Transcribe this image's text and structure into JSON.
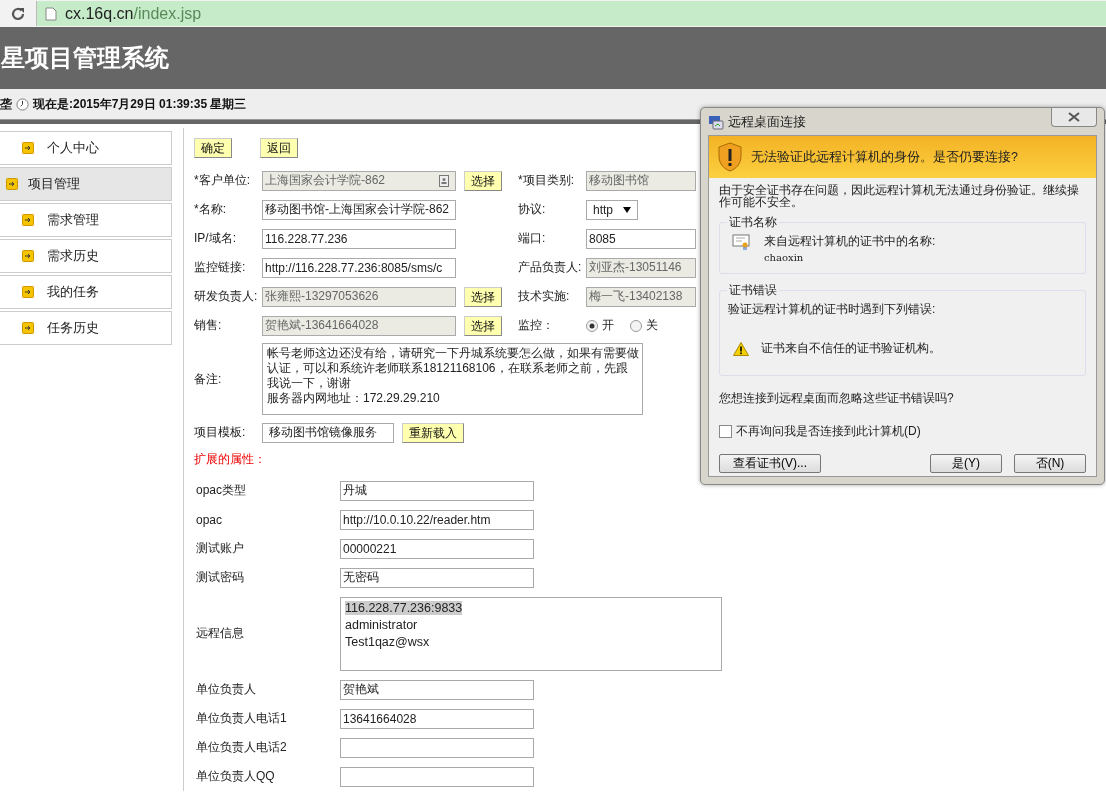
{
  "browser": {
    "url_host": "cx.16q.cn",
    "url_path": "/index.jsp"
  },
  "header": {
    "title": "星项目管理系统",
    "user": "垄",
    "datetime": "现在是:2015年7月29日 01:39:35 星期三"
  },
  "sidebar": {
    "items": [
      {
        "label": "个人中心",
        "selected": false
      },
      {
        "label": "项目管理",
        "selected": true
      },
      {
        "label": "需求管理",
        "selected": false
      },
      {
        "label": "需求历史",
        "selected": false
      },
      {
        "label": "我的任务",
        "selected": false
      },
      {
        "label": "任务历史",
        "selected": false
      }
    ]
  },
  "form": {
    "actions": [
      "确定",
      "返回"
    ],
    "rows": [
      {
        "label": "*客户单位:",
        "kind": "lookup",
        "value": "上海国家会计学院-862",
        "readonly": true,
        "button": "选择",
        "right": {
          "label": "*项目类别:",
          "kind": "input",
          "value": "移动图书馆",
          "readonly": true
        }
      },
      {
        "label": "*名称:",
        "kind": "input",
        "value": "移动图书馆-上海国家会计学院-862",
        "readonly": false,
        "right": {
          "label": "协议:",
          "kind": "select",
          "value": "http"
        }
      },
      {
        "label": "IP/域名:",
        "kind": "input",
        "value": "116.228.77.236",
        "readonly": false,
        "right": {
          "label": "端口:",
          "kind": "input",
          "value": "8085",
          "readonly": false
        }
      },
      {
        "label": "监控链接:",
        "kind": "input",
        "value": "http://116.228.77.236:8085/sms/c",
        "readonly": false,
        "right": {
          "label": "产品负责人:",
          "kind": "input",
          "value": "刘亚杰-13051146",
          "readonly": true
        }
      },
      {
        "label": "研发负责人:",
        "kind": "input",
        "value": "张雍熙-13297053626",
        "readonly": true,
        "button": "选择",
        "right": {
          "label": "技术实施:",
          "kind": "input",
          "value": "梅一飞-13402138",
          "readonly": true
        }
      },
      {
        "label": "销售:",
        "kind": "input",
        "value": "贺艳斌-13641664028",
        "readonly": true,
        "button": "选择",
        "right": {
          "label": "监控：",
          "kind": "radio",
          "options": [
            {
              "label": "开",
              "selected": true
            },
            {
              "label": "关",
              "selected": false
            }
          ]
        }
      }
    ],
    "remarks": {
      "label": "备注:",
      "lines": [
        "帐号老师这边还没有给，请研究一下丹城系统要怎么做，如果有需要做",
        "认证，可以和系统许老师联系18121168106，在联系老师之前，先跟",
        "我说一下，谢谢",
        "服务器内网地址：172.29.29.210"
      ]
    },
    "template": {
      "label": "项目模板:",
      "value": "移动图书馆镜像服务",
      "button": "重新载入"
    },
    "extended_title": "扩展的属性：",
    "extended": [
      {
        "label": "opac类型",
        "kind": "input",
        "value": "丹城"
      },
      {
        "label": "opac",
        "kind": "input",
        "value": "http://10.0.10.22/reader.htm"
      },
      {
        "label": "测试账户",
        "kind": "input",
        "value": "00000221"
      },
      {
        "label": "测试密码",
        "kind": "input",
        "value": "无密码"
      },
      {
        "label": "远程信息",
        "kind": "textarea",
        "lines": [
          {
            "text": "116.228.77.236:9833",
            "selected": true
          },
          {
            "text": "administrator",
            "selected": false
          },
          {
            "text": "Test1qaz@wsx",
            "selected": false
          }
        ]
      },
      {
        "label": "单位负责人",
        "kind": "input",
        "value": "贺艳斌"
      },
      {
        "label": "单位负责人电话1",
        "kind": "input",
        "value": "13641664028"
      },
      {
        "label": "单位负责人电话2",
        "kind": "input"
      },
      {
        "label": "单位负责人QQ",
        "kind": "input"
      }
    ]
  },
  "dialog": {
    "title": "远程桌面连接",
    "heading": "无法验证此远程计算机的身份。是否仍要连接?",
    "description": "由于安全证书存在问题，因此远程计算机无法通过身份验证。继续操作可能不安全。",
    "cert_group": {
      "title": "证书名称",
      "label": "来自远程计算机的证书中的名称:",
      "name": "chaoxin"
    },
    "error_group": {
      "title": "证书错误",
      "text": "验证远程计算机的证书时遇到下列错误:",
      "error": "证书来自不信任的证书验证机构。"
    },
    "question": "您想连接到远程桌面而忽略这些证书错误吗?",
    "checkbox": {
      "label": "不再询问我是否连接到此计算机(D)",
      "checked": false
    },
    "buttons": [
      "查看证书(V)...",
      "是(Y)",
      "否(N)"
    ]
  }
}
